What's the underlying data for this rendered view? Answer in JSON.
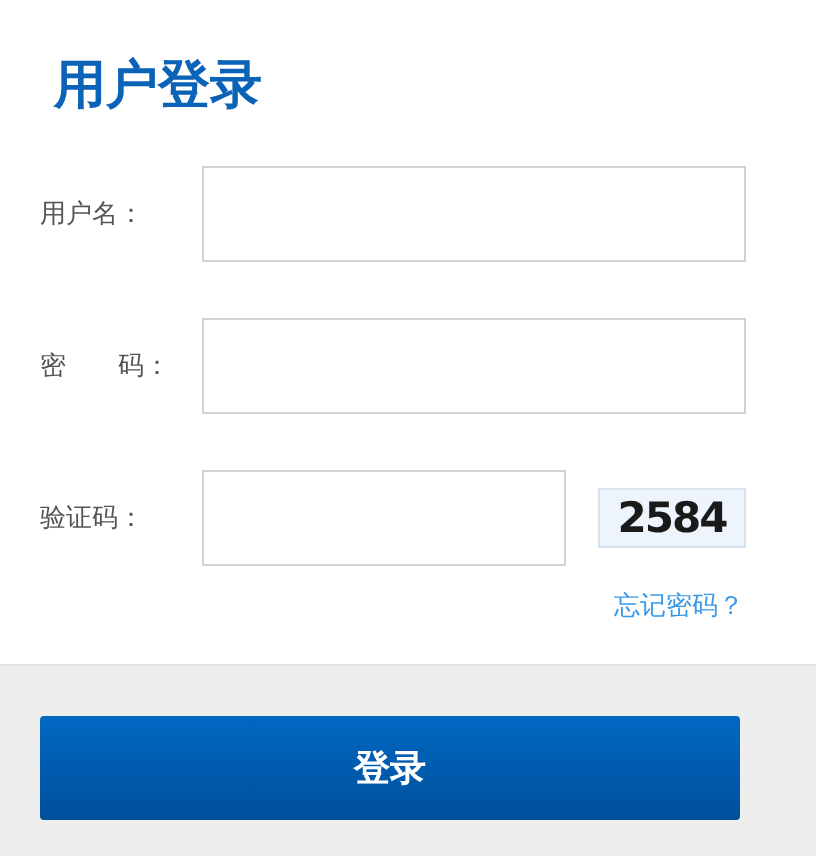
{
  "title": "用户登录",
  "fields": [
    {
      "kind": "text",
      "label": "用户名："
    },
    {
      "kind": "password",
      "label": "密　　码："
    },
    {
      "kind": "captcha",
      "label": "验证码：",
      "captcha": "2584"
    }
  ],
  "forgot_link": "忘记密码？",
  "submit_button": "登录"
}
